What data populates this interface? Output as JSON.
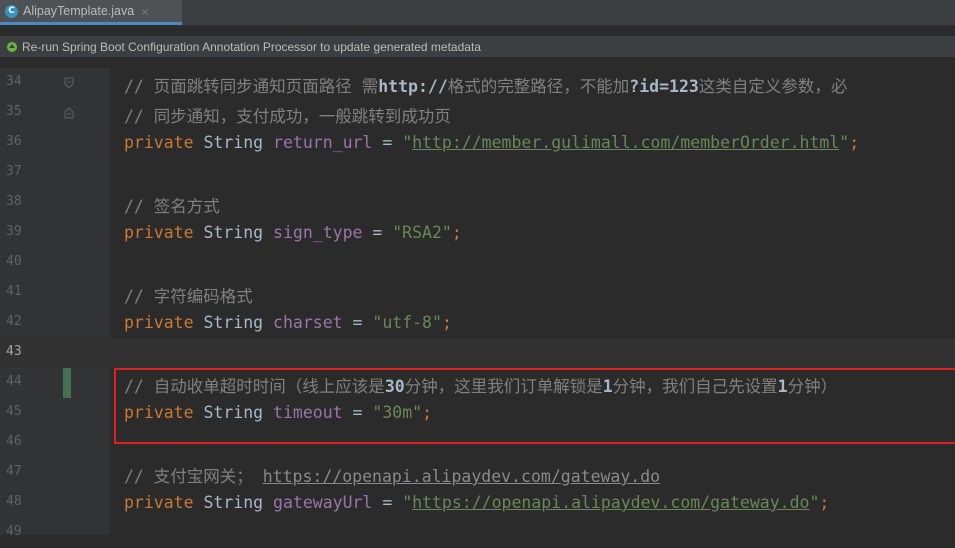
{
  "tab": {
    "title": "AlipayTemplate.java",
    "icon": "C",
    "close": "×"
  },
  "notice": {
    "text": "Re-run Spring Boot Configuration Annotation Processor to update generated metadata"
  },
  "lines": [
    {
      "no": "34"
    },
    {
      "no": "35"
    },
    {
      "no": "36"
    },
    {
      "no": "37"
    },
    {
      "no": "38"
    },
    {
      "no": "39"
    },
    {
      "no": "40"
    },
    {
      "no": "41"
    },
    {
      "no": "42"
    },
    {
      "no": "43"
    },
    {
      "no": "44"
    },
    {
      "no": "45"
    },
    {
      "no": "46"
    },
    {
      "no": "47"
    },
    {
      "no": "48"
    },
    {
      "no": "49"
    }
  ],
  "code": {
    "l34": {
      "a": "// 页面跳转同步通知页面路径 需",
      "b": "http://",
      "c": "格式的完整路径，不能加",
      "d": "?id=123",
      "e": "这类自定义参数，必"
    },
    "l35": "// 同步通知，支付成功，一般跳转到成功页",
    "l36": {
      "kw": "private",
      "type": "String",
      "name": "return_url",
      "eq": "=",
      "q1": "\"",
      "url": "http://member.gulimall.com/memberOrder.html",
      "q2": "\"",
      "semi": ";"
    },
    "l38": "// 签名方式",
    "l39": {
      "kw": "private",
      "type": "String",
      "name": "sign_type",
      "eq": "=",
      "str": "\"RSA2\"",
      "semi": ";"
    },
    "l41": "// 字符编码格式",
    "l42": {
      "kw": "private",
      "type": "String",
      "name": "charset",
      "eq": "=",
      "str": "\"utf-8\"",
      "semi": ";"
    },
    "l44": {
      "a": "// 自动收单超时时间（线上应该是",
      "b": "30",
      "c": "分钟，这里我们订单解锁是",
      "d": "1",
      "e": "分钟，我们自己先设置",
      "f": "1",
      "g": "分钟）"
    },
    "l45": {
      "kw": "private",
      "type": "String",
      "name": "timeout",
      "eq": "=",
      "str": "\"30m\"",
      "semi": ";"
    },
    "l47": {
      "a": "// 支付宝网关；",
      "url": "https://openapi.alipaydev.com/gateway.do"
    },
    "l48": {
      "kw": "private",
      "type": "String",
      "name": "gatewayUrl",
      "eq": "=",
      "q1": "\"",
      "url": "https://openapi.alipaydev.com/gateway.do",
      "q2": "\"",
      "semi": ";"
    }
  }
}
